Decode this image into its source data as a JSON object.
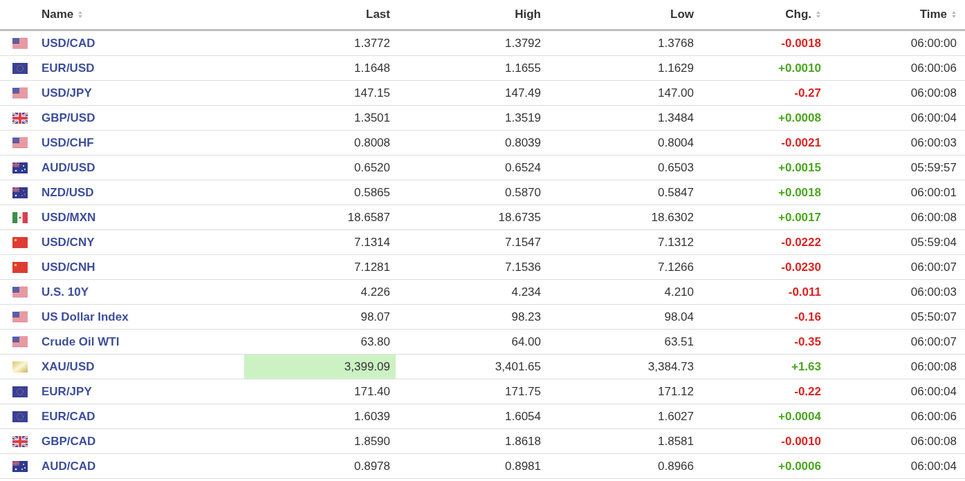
{
  "columns": [
    {
      "label": "Name",
      "sortable": true
    },
    {
      "label": "Last",
      "sortable": false
    },
    {
      "label": "High",
      "sortable": false
    },
    {
      "label": "Low",
      "sortable": false
    },
    {
      "label": "Chg.",
      "sortable": true
    },
    {
      "label": "Time",
      "sortable": true
    }
  ],
  "rows": [
    {
      "kind": "us",
      "name": "USD/CAD",
      "last": "1.3772",
      "high": "1.3792",
      "low": "1.3768",
      "chg": "-0.0018",
      "color": "#dd2222",
      "time": "06:00:00",
      "last_highlighted": false
    },
    {
      "kind": "eu",
      "name": "EUR/USD",
      "last": "1.1648",
      "high": "1.1655",
      "low": "1.1629",
      "chg": "+0.0010",
      "color": "#4aa61f",
      "time": "06:00:06",
      "last_highlighted": false
    },
    {
      "kind": "us",
      "name": "USD/JPY",
      "last": "147.15",
      "high": "147.49",
      "low": "147.00",
      "chg": "-0.27",
      "color": "#dd2222",
      "time": "06:00:08",
      "last_highlighted": false
    },
    {
      "kind": "gb",
      "name": "GBP/USD",
      "last": "1.3501",
      "high": "1.3519",
      "low": "1.3484",
      "chg": "+0.0008",
      "color": "#4aa61f",
      "time": "06:00:04",
      "last_highlighted": false
    },
    {
      "kind": "us",
      "name": "USD/CHF",
      "last": "0.8008",
      "high": "0.8039",
      "low": "0.8004",
      "chg": "-0.0021",
      "color": "#dd2222",
      "time": "06:00:03",
      "last_highlighted": false
    },
    {
      "kind": "au",
      "name": "AUD/USD",
      "last": "0.6520",
      "high": "0.6524",
      "low": "0.6503",
      "chg": "+0.0015",
      "color": "#4aa61f",
      "time": "05:59:57",
      "last_highlighted": false
    },
    {
      "kind": "nz",
      "name": "NZD/USD",
      "last": "0.5865",
      "high": "0.5870",
      "low": "0.5847",
      "chg": "+0.0018",
      "color": "#4aa61f",
      "time": "06:00:01",
      "last_highlighted": false
    },
    {
      "kind": "mx",
      "name": "USD/MXN",
      "last": "18.6587",
      "high": "18.6735",
      "low": "18.6302",
      "chg": "+0.0017",
      "color": "#4aa61f",
      "time": "06:00:08",
      "last_highlighted": false
    },
    {
      "kind": "cn",
      "name": "USD/CNY",
      "last": "7.1314",
      "high": "7.1547",
      "low": "7.1312",
      "chg": "-0.0222",
      "color": "#dd2222",
      "time": "05:59:04",
      "last_highlighted": false
    },
    {
      "kind": "cn",
      "name": "USD/CNH",
      "last": "7.1281",
      "high": "7.1536",
      "low": "7.1266",
      "chg": "-0.0230",
      "color": "#dd2222",
      "time": "06:00:07",
      "last_highlighted": false
    },
    {
      "kind": "us",
      "name": "U.S. 10Y",
      "last": "4.226",
      "high": "4.234",
      "low": "4.210",
      "chg": "-0.011",
      "color": "#dd2222",
      "time": "06:00:03",
      "last_highlighted": false
    },
    {
      "kind": "us",
      "name": "US Dollar Index",
      "last": "98.07",
      "high": "98.23",
      "low": "98.04",
      "chg": "-0.16",
      "color": "#dd2222",
      "time": "05:50:07",
      "last_highlighted": false
    },
    {
      "kind": "us",
      "name": "Crude Oil WTI",
      "last": "63.80",
      "high": "64.00",
      "low": "63.51",
      "chg": "-0.35",
      "color": "#dd2222",
      "time": "06:00:07",
      "last_highlighted": false
    },
    {
      "kind": "gold",
      "name": "XAU/USD",
      "last": "3,399.09",
      "high": "3,401.65",
      "low": "3,384.73",
      "chg": "+1.63",
      "color": "#4aa61f",
      "time": "06:00:08",
      "last_highlighted": true
    },
    {
      "kind": "eu",
      "name": "EUR/JPY",
      "last": "171.40",
      "high": "171.75",
      "low": "171.12",
      "chg": "-0.22",
      "color": "#dd2222",
      "time": "06:00:04",
      "last_highlighted": false
    },
    {
      "kind": "eu",
      "name": "EUR/CAD",
      "last": "1.6039",
      "high": "1.6054",
      "low": "1.6027",
      "chg": "+0.0004",
      "color": "#4aa61f",
      "time": "06:00:06",
      "last_highlighted": false
    },
    {
      "kind": "gb",
      "name": "GBP/CAD",
      "last": "1.8590",
      "high": "1.8618",
      "low": "1.8581",
      "chg": "-0.0010",
      "color": "#dd2222",
      "time": "06:00:08",
      "last_highlighted": false
    },
    {
      "kind": "au",
      "name": "AUD/CAD",
      "last": "0.8978",
      "high": "0.8981",
      "low": "0.8966",
      "chg": "+0.0006",
      "color": "#4aa61f",
      "time": "06:00:04",
      "last_highlighted": false
    }
  ]
}
